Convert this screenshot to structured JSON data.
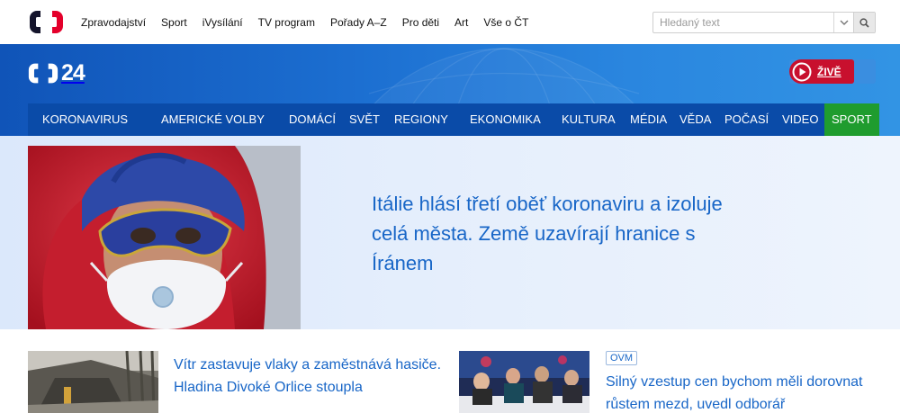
{
  "topbar": {
    "logo_icon": "ct-logo-icon",
    "nav": [
      "Zpravodajství",
      "Sport",
      "iVysílání",
      "TV program",
      "Pořady A–Z",
      "Pro děti",
      "Art",
      "Vše o ČT"
    ],
    "search": {
      "placeholder": "Hledaný text",
      "value": ""
    }
  },
  "header": {
    "logo_text": "24",
    "live_label": "ŽIVĚ",
    "colors": {
      "band": "#1c6fd1",
      "nav": "#0a4ba8",
      "live": "#c8102e",
      "sport": "#1f9c2e"
    }
  },
  "mainnav": [
    {
      "label": "KORONAVIRUS"
    },
    {
      "label": "AMERICKÉ VOLBY"
    },
    {
      "label": "DOMÁCÍ"
    },
    {
      "label": "SVĚT"
    },
    {
      "label": "REGIONY"
    },
    {
      "label": "EKONOMIKA"
    },
    {
      "label": "KULTURA"
    },
    {
      "label": "MÉDIA"
    },
    {
      "label": "VĚDA"
    },
    {
      "label": "POČASÍ"
    },
    {
      "label": "VIDEO"
    },
    {
      "label": "SPORT"
    }
  ],
  "hero": {
    "title": "Itálie hlásí třetí oběť koronaviru a izoluje celá města. Země uzavírají hranice s Íránem"
  },
  "articles": [
    {
      "title": "Vítr zastavuje vlaky a zaměstnává hasiče. Hladina Divoké Orlice stoupla"
    },
    {
      "badge": "OVM",
      "title": "Silný vzestup cen bychom měli dorovnat růstem mezd, uvedl odborář"
    }
  ]
}
